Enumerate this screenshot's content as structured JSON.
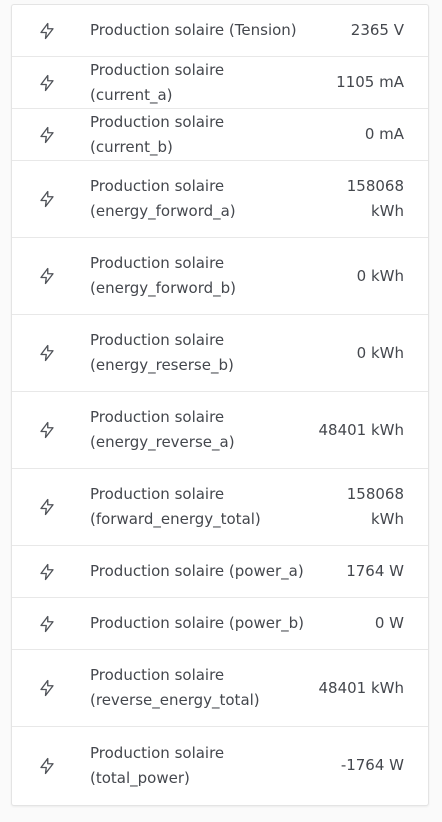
{
  "colors": {
    "text": "#44474d",
    "border": "#e8e8e8",
    "icon": "#505359"
  },
  "rows": [
    {
      "icon": "lightning-icon",
      "label": "Production solaire (Tension)",
      "value": "2365 V"
    },
    {
      "icon": "lightning-icon",
      "label": "Production solaire (current_a)",
      "value": "1105 mA"
    },
    {
      "icon": "lightning-icon",
      "label": "Production solaire (current_b)",
      "value": "0 mA"
    },
    {
      "icon": "lightning-icon",
      "label": "Production solaire (energy_forword_a)",
      "value": "158068 kWh"
    },
    {
      "icon": "lightning-icon",
      "label": "Production solaire (energy_forword_b)",
      "value": "0 kWh"
    },
    {
      "icon": "lightning-icon",
      "label": "Production solaire (energy_reserse_b)",
      "value": "0 kWh"
    },
    {
      "icon": "lightning-icon",
      "label": "Production solaire (energy_reverse_a)",
      "value": "48401 kWh"
    },
    {
      "icon": "lightning-icon",
      "label": "Production solaire (forward_energy_total)",
      "value": "158068 kWh"
    },
    {
      "icon": "lightning-icon",
      "label": "Production solaire (power_a)",
      "value": "1764 W"
    },
    {
      "icon": "lightning-icon",
      "label": "Production solaire (power_b)",
      "value": "0 W"
    },
    {
      "icon": "lightning-icon",
      "label": "Production solaire (reverse_energy_total)",
      "value": "48401 kWh"
    },
    {
      "icon": "lightning-icon",
      "label": "Production solaire (total_power)",
      "value": "-1764 W"
    }
  ]
}
